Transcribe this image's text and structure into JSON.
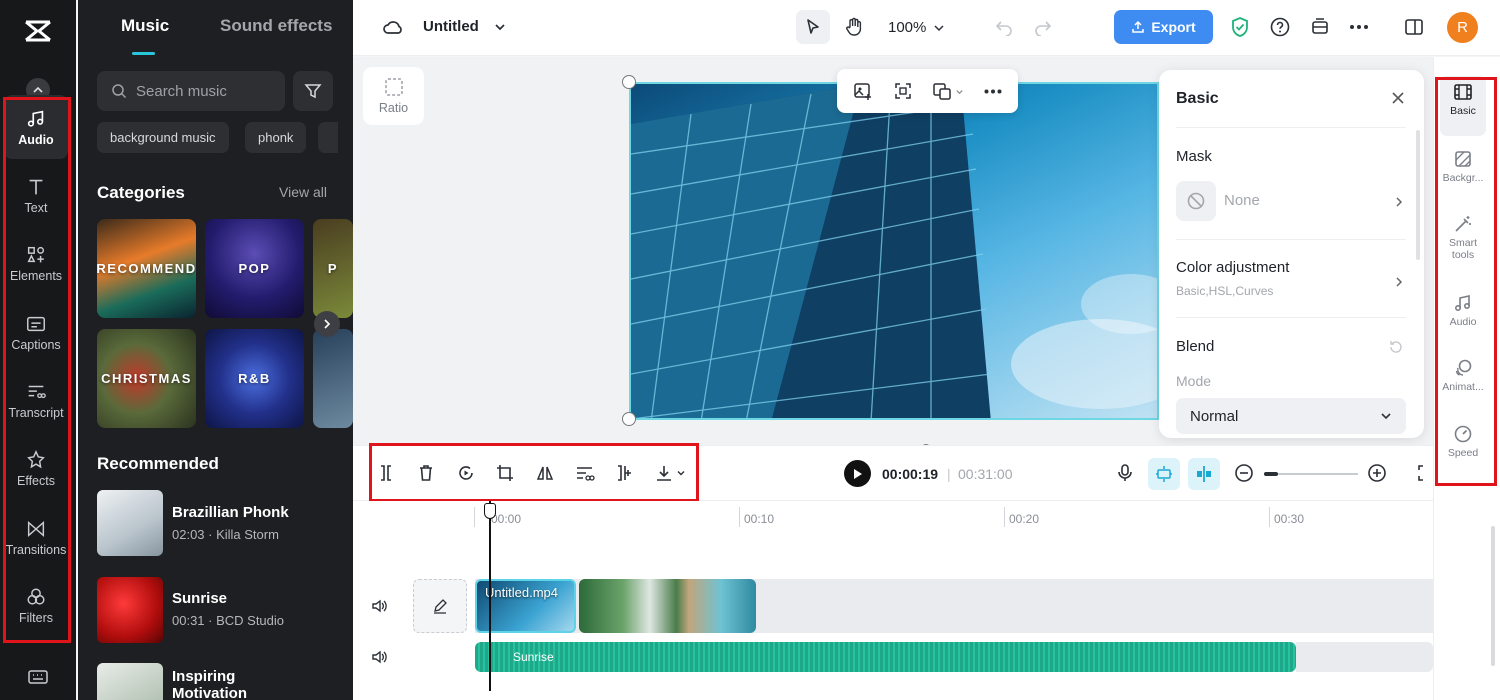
{
  "nav": {
    "items": [
      {
        "label": "Audio",
        "icon": "music-note-icon",
        "active": true
      },
      {
        "label": "Text",
        "icon": "text-t-icon"
      },
      {
        "label": "Elements",
        "icon": "elements-icon"
      },
      {
        "label": "Captions",
        "icon": "captions-icon"
      },
      {
        "label": "Transcript",
        "icon": "transcript-icon"
      },
      {
        "label": "Effects",
        "icon": "effects-star-icon"
      },
      {
        "label": "Transitions",
        "icon": "transitions-bowtie-icon"
      },
      {
        "label": "Filters",
        "icon": "filters-circles-icon"
      }
    ]
  },
  "panel": {
    "tabs": [
      "Music",
      "Sound effects"
    ],
    "search_placeholder": "Search music",
    "chips": [
      "background music",
      "phonk"
    ],
    "categories_title": "Categories",
    "view_all": "View all",
    "categories": [
      "RECOMMEND",
      "POP",
      "P",
      "CHRISTMAS",
      "R&B"
    ],
    "recommended_title": "Recommended",
    "recommended": [
      {
        "title": "Brazillian Phonk",
        "sub": "02:03 · Killa Storm"
      },
      {
        "title": "Sunrise",
        "sub": "00:31 · BCD Studio"
      },
      {
        "title": "Inspiring Motivation",
        "sub": ""
      }
    ]
  },
  "topbar": {
    "project_name": "Untitled",
    "zoom": "100%",
    "export_label": "Export",
    "avatar_letter": "R"
  },
  "canvas": {
    "ratio_label": "Ratio"
  },
  "props": {
    "title": "Basic",
    "mask_label": "Mask",
    "mask_value": "None",
    "color_label": "Color adjustment",
    "color_sub": "Basic,HSL,Curves",
    "blend_label": "Blend",
    "mode_label": "Mode",
    "mode_value": "Normal"
  },
  "right_tools": [
    {
      "label": "Basic",
      "icon": "film-icon",
      "active": true
    },
    {
      "label": "Backgr...",
      "icon": "background-icon"
    },
    {
      "label": "Smart tools",
      "icon": "magic-wand-icon"
    },
    {
      "label": "Audio",
      "icon": "music-note-icon"
    },
    {
      "label": "Animat...",
      "icon": "animation-icon"
    },
    {
      "label": "Speed",
      "icon": "speed-icon"
    }
  ],
  "player": {
    "current": "00:00:19",
    "total": "00:31:00"
  },
  "timeline": {
    "ruler": [
      "00:00",
      "00:10",
      "00:20",
      "00:30"
    ],
    "clip_name": "Untitled.mp4",
    "audio_name": "Sunrise"
  },
  "colors": {
    "accent": "#3e8cf1",
    "highlight_box": "#e0151b",
    "audio_track": "#1fa78a",
    "avatar": "#f07f1e"
  }
}
